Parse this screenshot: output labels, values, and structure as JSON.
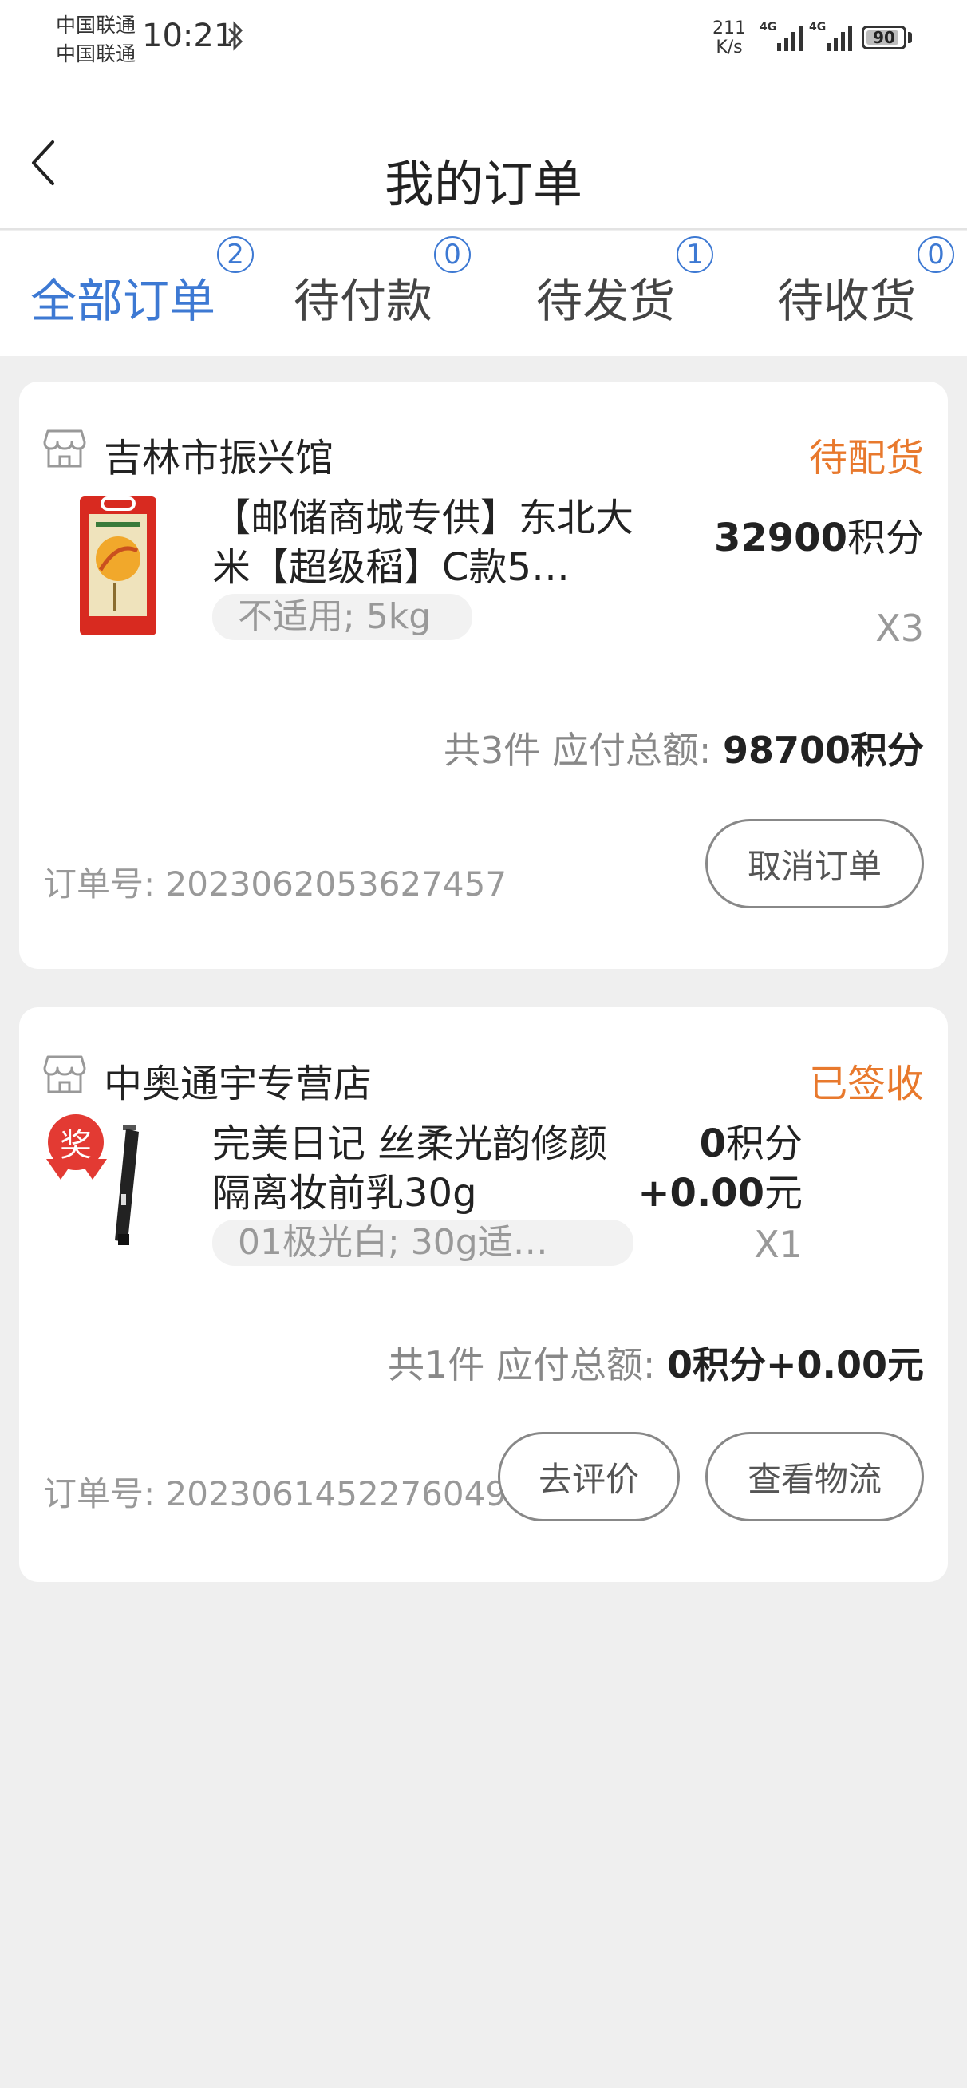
{
  "status_bar": {
    "carrier_1": "中国联通",
    "carrier_2": "中国联通",
    "time": "10:21",
    "net_speed_value": "211",
    "net_speed_unit": "K/s",
    "signal_label_1": "4G",
    "signal_label_2": "4G",
    "battery": "90",
    "battery_level": 0.9
  },
  "header": {
    "title": "我的订单"
  },
  "tabs": [
    {
      "label": "全部订单",
      "count": "2",
      "active": true
    },
    {
      "label": "待付款",
      "count": "0",
      "active": false
    },
    {
      "label": "待发货",
      "count": "1",
      "active": false
    },
    {
      "label": "待收货",
      "count": "0",
      "active": false
    }
  ],
  "orders": [
    {
      "shop_name": "吉林市振兴馆",
      "status": "待配货",
      "product_title": "【邮储商城专供】东北大米【超级稻】C款5…",
      "spec": "不适用; 5kg",
      "price_points": "32900",
      "price_points_unit": "积分",
      "quantity": "X3",
      "summary": "共3件 应付总额:",
      "total": "98700积分",
      "order_no": "订单号: 2023062053627457",
      "buttons": [
        "取消订单"
      ]
    },
    {
      "shop_name": "中奥通宇专营店",
      "status": "已签收",
      "product_title": "完美日记 丝柔光韵修颜隔离妆前乳30g",
      "spec": "01极光白; 30g适…",
      "price_points": "0",
      "price_points_unit": "积分",
      "price_cash": "+0.00",
      "price_cash_unit": "元",
      "quantity": "X1",
      "award_badge": "奖",
      "summary": "共1件 应付总额:",
      "total": "0积分+0.00元",
      "order_no": "订单号: 2023061452276049",
      "buttons": [
        "去评价",
        "查看物流"
      ]
    }
  ],
  "colors": {
    "accent_blue": "#3d79d3",
    "status_orange": "#e8792d",
    "background": "#efefef"
  }
}
